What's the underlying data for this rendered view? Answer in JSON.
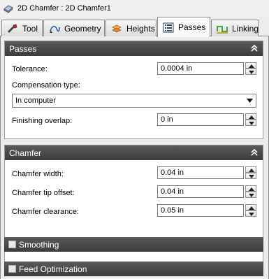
{
  "window": {
    "title": "2D Chamfer : 2D Chamfer1"
  },
  "tabs": [
    {
      "label": "Tool",
      "icon": "tool-icon"
    },
    {
      "label": "Geometry",
      "icon": "geometry-icon"
    },
    {
      "label": "Heights",
      "icon": "heights-icon"
    },
    {
      "label": "Passes",
      "icon": "passes-icon",
      "active": true
    },
    {
      "label": "Linking",
      "icon": "linking-icon"
    }
  ],
  "passes": {
    "header": "Passes",
    "tolerance_label": "Tolerance:",
    "tolerance_value": "0.0004 in",
    "compensation_label": "Compensation type:",
    "compensation_value": "In computer",
    "finishing_overlap_label": "Finishing overlap:",
    "finishing_overlap_value": "0 in"
  },
  "chamfer": {
    "header": "Chamfer",
    "width_label": "Chamfer width:",
    "width_value": "0.04 in",
    "tip_offset_label": "Chamfer tip offset:",
    "tip_offset_value": "0.04 in",
    "clearance_label": "Chamfer clearance:",
    "clearance_value": "0.05 in"
  },
  "smoothing": {
    "header": "Smoothing",
    "checked": false
  },
  "feed_optimization": {
    "header": "Feed Optimization",
    "checked": false
  },
  "colors": {
    "section_header": "#4a4a4a",
    "background": "#ececec"
  }
}
